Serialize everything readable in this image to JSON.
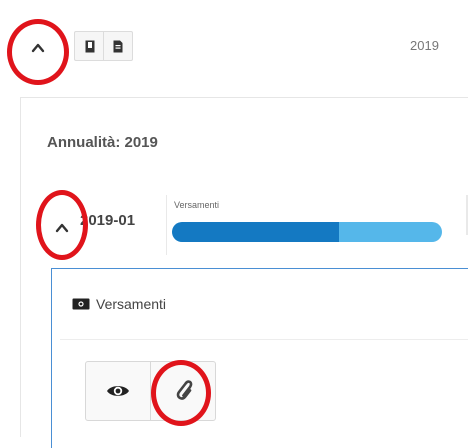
{
  "header": {
    "year": "2019",
    "toggle_icon": "chevron-up-icon",
    "buttons": [
      {
        "icon": "book-icon"
      },
      {
        "icon": "document-icon"
      }
    ]
  },
  "panel": {
    "title": "Annualità: 2019",
    "period": {
      "label": "2019-01",
      "toggle_icon": "chevron-up-icon",
      "progress_caption": "Versamenti",
      "progress_dark_fraction": 0.62,
      "colors": {
        "dark": "#1479c2",
        "light": "#55b7ea"
      }
    },
    "section": {
      "title": "Versamenti",
      "icon": "money-icon",
      "actions": [
        {
          "icon": "eye-icon"
        },
        {
          "icon": "paperclip-icon"
        }
      ]
    }
  },
  "annotation_color": "#e0141b"
}
